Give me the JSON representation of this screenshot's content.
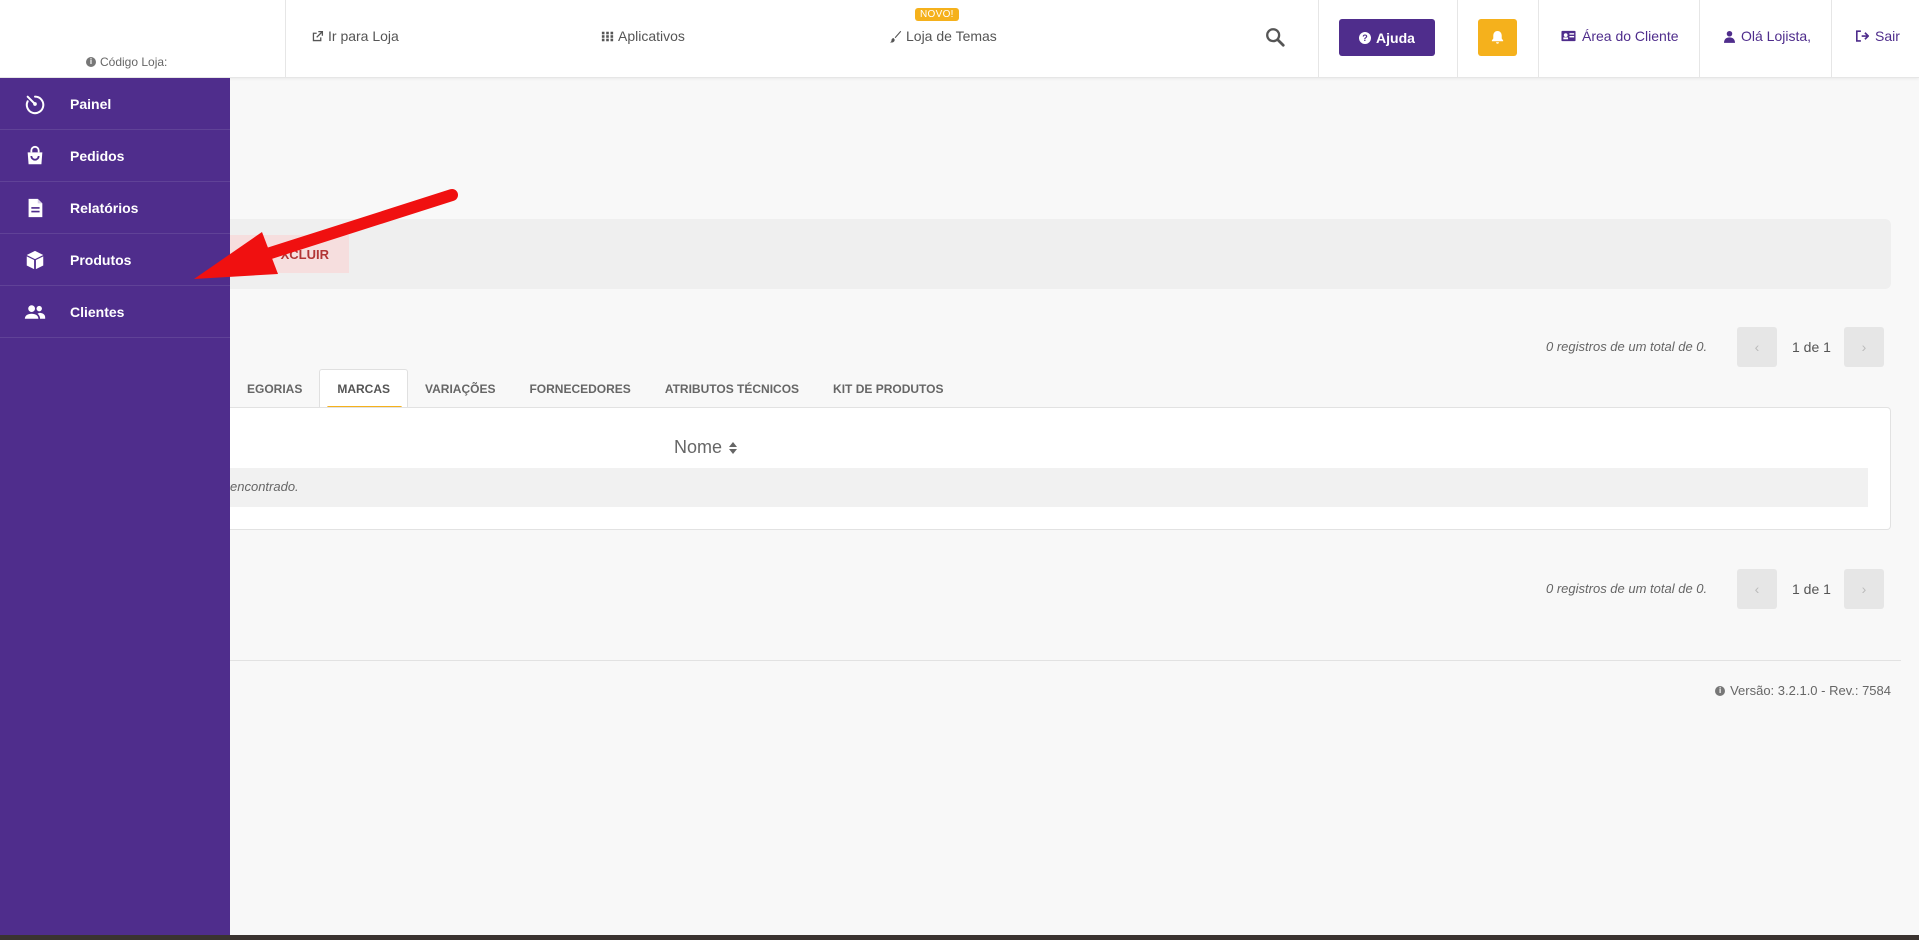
{
  "header": {
    "store_code_label": "Código Loja:",
    "links": {
      "go_to_store": "Ir para Loja",
      "apps": "Aplicativos",
      "themes": "Loja de Temas",
      "themes_badge": "NOVO!"
    },
    "help_label": "Ajuda",
    "client_area": "Área do Cliente",
    "greeting": "Olá Lojista,",
    "logout": "Sair"
  },
  "sidebar": {
    "items": [
      {
        "label": "Painel",
        "icon": "dashboard-icon"
      },
      {
        "label": "Pedidos",
        "icon": "shopping-bag-icon"
      },
      {
        "label": "Relatórios",
        "icon": "document-icon"
      },
      {
        "label": "Produtos",
        "icon": "box-icon"
      },
      {
        "label": "Clientes",
        "icon": "users-icon"
      }
    ]
  },
  "actions": {
    "delete_label": "XCLUIR"
  },
  "pagination": {
    "records_text": "0 registros de um total de 0.",
    "page_text": "1 de 1"
  },
  "tabs": [
    {
      "label": "EGORIAS",
      "active": false
    },
    {
      "label": "MARCAS",
      "active": true
    },
    {
      "label": "VARIAÇÕES",
      "active": false
    },
    {
      "label": "FORNECEDORES",
      "active": false
    },
    {
      "label": "ATRIBUTOS TÉCNICOS",
      "active": false
    },
    {
      "label": "KIT DE PRODUTOS",
      "active": false
    }
  ],
  "table": {
    "column_name": "Nome",
    "empty_text": "encontrado."
  },
  "footer": {
    "version": "Versão: 3.2.1.0 - Rev.: 7584"
  },
  "colors": {
    "brand_purple": "#4f2d8c",
    "accent_yellow": "#f5b11c",
    "annotation_red": "#f01010"
  }
}
